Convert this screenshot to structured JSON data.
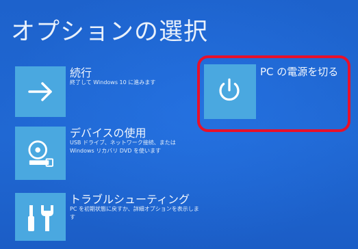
{
  "screen": {
    "title": "オプションの選択"
  },
  "options": [
    {
      "label": "続行",
      "description": "終了して Windows 10 に進みます",
      "icon": "arrow-right-icon"
    },
    {
      "label": "デバイスの使用",
      "description": "USB ドライブ、ネットワーク接続、または Windows リカバリ DVD を使います",
      "icon": "disc-drive-icon"
    },
    {
      "label": "トラブルシューティング",
      "description": "PC を初期状態に戻すか、詳細オプションを表示します",
      "icon": "tools-icon"
    }
  ],
  "power": {
    "label": "PC の電源を切る",
    "icon": "power-icon"
  },
  "colors": {
    "background": "#1f66cf",
    "tile": "#4aa8e0",
    "highlight": "#e8102a",
    "text": "#ffffff"
  }
}
